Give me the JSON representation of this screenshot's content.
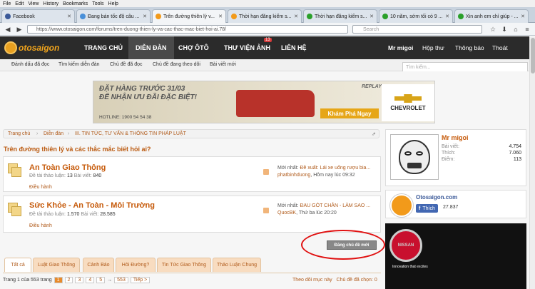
{
  "browser": {
    "menu": [
      "File",
      "Edit",
      "View",
      "History",
      "Bookmarks",
      "Tools",
      "Help"
    ],
    "tabs": [
      {
        "label": "Facebook",
        "color": "#3b5998"
      },
      {
        "label": "Đang bán tốc độ câu ...",
        "color": "#4a90d9"
      },
      {
        "label": "Trên đường thiên lý v...",
        "color": "#f29a1a"
      },
      {
        "label": "Thời hạn đăng kiểm s...",
        "color": "#f29a1a"
      },
      {
        "label": "Thời hạn đăng kiểm s...",
        "color": "#2aa02a"
      },
      {
        "label": "10 năm, sớm tối có 9 ...",
        "color": "#2aa02a"
      },
      {
        "label": "Xin anh em chỉ giúp - ...",
        "color": "#2aa02a"
      }
    ],
    "url": "https://www.otosaigon.com/forums/tren-duong-thien-ly-va-cac-thac-mac-biet-hoi-ai.78/",
    "search_placeholder": "Search"
  },
  "site": {
    "logo": "otosaigon",
    "nav": [
      "TRANG CHỦ",
      "DIỄN ĐÀN",
      "CHỢ ÔTÔ",
      "THƯ VIỆN ẢNH",
      "LIÊN HỆ"
    ],
    "nav_badge": "13",
    "user_nav": [
      "Mr migoi",
      "Hộp thư",
      "Thông báo",
      "Thoát"
    ],
    "subnav": [
      "Đánh dấu đã đọc",
      "Tìm kiếm diễn đàn",
      "Chủ đề đã đọc",
      "Chủ đề đang theo dõi",
      "Bài viết mới"
    ],
    "search_placeholder": "Tìm kiếm..."
  },
  "ad": {
    "line1": "ĐẶT HÀNG TRƯỚC 31/03",
    "line2": "ĐỂ NHẬN ƯU ĐÃI ĐẶC BIỆT!",
    "hotline": "HOTLINE: 1900 54 54 38",
    "replay": "REPLAY",
    "cta": "Khám Phá Ngay",
    "brand": "CHEVROLET"
  },
  "breadcrumb": [
    "Trang chủ",
    "Diễn đàn",
    "III. TIN TỨC, TƯ VẤN & THÔNG TIN PHÁP LUẬT"
  ],
  "page_title": "Trên đường thiên lý và các thắc mắc biết hỏi ai?",
  "forums": [
    {
      "name": "An Toàn Giao Thông",
      "threads_label": "Đề tài thảo luận",
      "threads": "13",
      "posts_label": "Bài viết",
      "posts": "840",
      "tools": "Điều hành",
      "latest_label": "Mới nhất:",
      "latest_title": "Đề xuất: Lái xe uống rượu bia...",
      "latest_user": "phatbinhduong",
      "latest_time": "Hôm nay lúc 09:32"
    },
    {
      "name": "Sức Khỏe - An Toàn - Môi Trường",
      "threads_label": "Đề tài thảo luận",
      "threads": "1.570",
      "posts_label": "Bài viết",
      "posts": "28.585",
      "tools": "Điều hành",
      "latest_label": "Mới nhất:",
      "latest_title": "ĐAU GÓT CHÂN - LÀM SAO ...",
      "latest_user": "QuocBK",
      "latest_time": "Thứ ba lúc 20:20"
    }
  ],
  "new_thread_button": "Đăng chủ đề mới",
  "filter_tabs": [
    "Tất cả",
    "Luật Giao Thông",
    "Cảnh Báo",
    "Hỏi Đường?",
    "Tin Tức Giao Thông",
    "Thảo Luận Chung"
  ],
  "pager": {
    "text": "Trang 1 của 553 trang",
    "pages": [
      "1",
      "2",
      "3",
      "4",
      "5"
    ],
    "ellipsis": "→",
    "last": "553",
    "next": "Tiếp >"
  },
  "pager_right": {
    "follow": "Theo dõi mục này",
    "selected": "Chủ đề đã chọn: 0"
  },
  "profile": {
    "name": "Mr migoi",
    "stats": [
      {
        "label": "Bài viết:",
        "value": "4.754"
      },
      {
        "label": "Thích:",
        "value": "7.060"
      },
      {
        "label": "Điểm:",
        "value": "113"
      }
    ]
  },
  "fb_widget": {
    "name": "Otosaigon.com",
    "like": "Thích",
    "count": "27.837"
  },
  "nissan_ad": {
    "brand": "NISSAN",
    "tag": "Innovation that excites"
  }
}
